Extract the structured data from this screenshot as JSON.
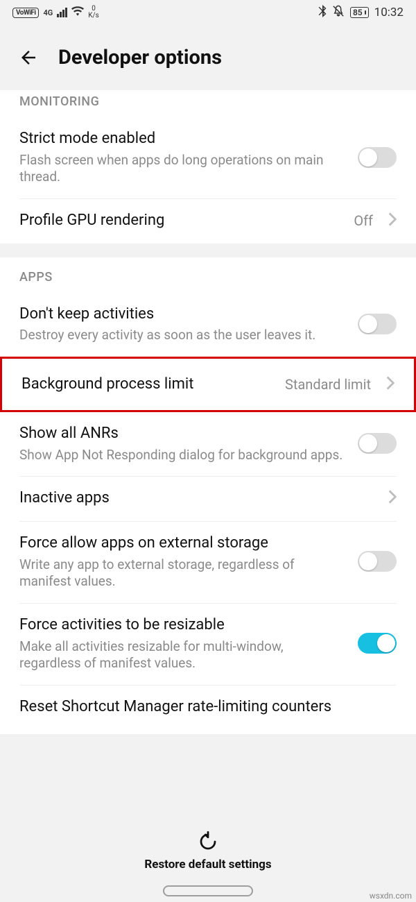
{
  "status": {
    "vowifi": "VoWiFi",
    "net": "4G",
    "speed_value": "0",
    "speed_unit": "K/s",
    "battery": "85",
    "time": "10:32"
  },
  "header": {
    "title": "Developer options"
  },
  "sections": {
    "monitoring_header": "MONITORING",
    "apps_header": "APPS"
  },
  "items": {
    "strict_mode": {
      "title": "Strict mode enabled",
      "sub": "Flash screen when apps do long operations on main thread."
    },
    "profile_gpu": {
      "title": "Profile GPU rendering",
      "value": "Off"
    },
    "dont_keep": {
      "title": "Don't keep activities",
      "sub": "Destroy every activity as soon as the user leaves it."
    },
    "bg_limit": {
      "title": "Background process limit",
      "value": "Standard limit"
    },
    "show_anrs": {
      "title": "Show all ANRs",
      "sub": "Show App Not Responding dialog for background apps."
    },
    "inactive_apps": {
      "title": "Inactive apps"
    },
    "force_external": {
      "title": "Force allow apps on external storage",
      "sub": "Write any app to external storage, regardless of manifest values."
    },
    "force_resizable": {
      "title": "Force activities to be resizable",
      "sub": "Make all activities resizable for multi-window, regardless of manifest values."
    },
    "reset_shortcut": {
      "title": "Reset Shortcut Manager rate-limiting counters"
    }
  },
  "footer": {
    "restore": "Restore default settings"
  },
  "watermark": "wsxdn.com"
}
